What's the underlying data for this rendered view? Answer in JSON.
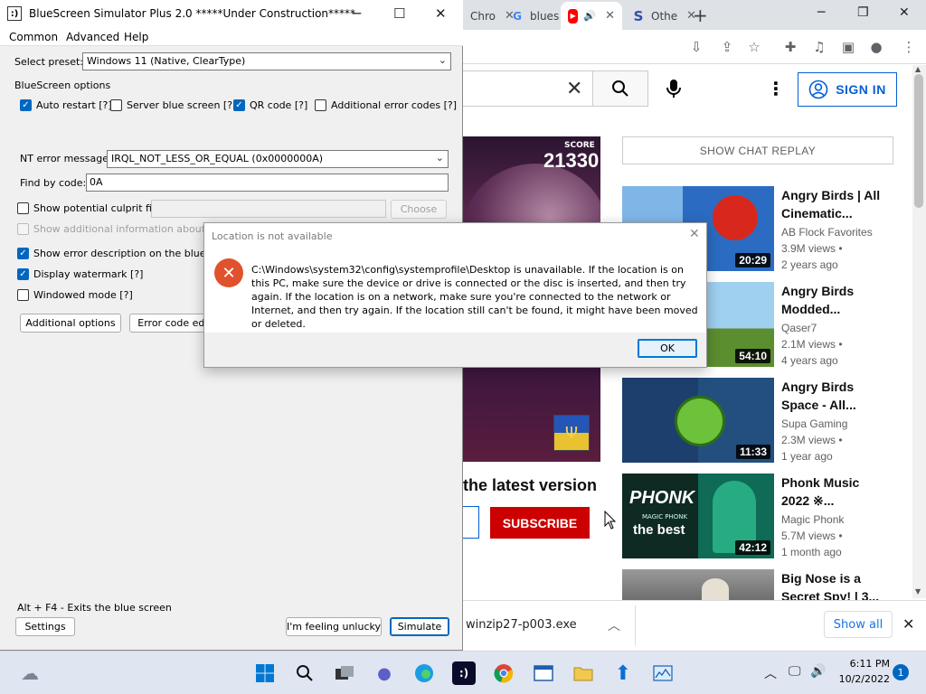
{
  "chrome": {
    "tabs": [
      {
        "label": "Chro"
      },
      {
        "label": "blues"
      },
      {
        "label": ""
      },
      {
        "label": "Othe"
      }
    ],
    "yt": {
      "signin": "SIGN IN",
      "score_label": "SCORE",
      "score": "21330",
      "latest_text": "the latest version",
      "subscribe": "SUBSCRIBE",
      "chat_replay": "SHOW CHAT REPLAY",
      "recommendations": [
        {
          "title": "Angry Birds | All\nCinematic...",
          "channel": "AB Flock Favorites",
          "stats": "3.9M views •\n2 years ago",
          "duration": "20:29"
        },
        {
          "title": "Angry Birds\nModded...",
          "channel": "Qaser7",
          "stats": "2.1M views •\n4 years ago",
          "duration": "54:10"
        },
        {
          "title": "Angry Birds\nSpace - All...",
          "channel": "Supa Gaming",
          "stats": "2.3M views •\n1 year ago",
          "duration": "11:33"
        },
        {
          "title": "Phonk Music\n2022 ※...",
          "channel": "Magic Phonk",
          "stats": "5.7M views •\n1 month ago",
          "duration": "42:12",
          "thumb_text_1": "PHONK",
          "thumb_text_2": "MAGIC PHONK",
          "thumb_text_3": "the best"
        },
        {
          "title": "Big Nose is a\nSecret Spy! | 3...",
          "channel": "",
          "stats": "",
          "duration": ""
        }
      ]
    },
    "downloads": {
      "file": "winzip27-p003.exe",
      "show_all": "Show all"
    }
  },
  "bss": {
    "title": "BlueScreen Simulator Plus 2.0 *****Under Construction*****",
    "menu": [
      "Common",
      "Advanced",
      "Help"
    ],
    "preset_label": "Select preset:",
    "preset_value": "Windows 11 (Native, ClearType)",
    "options_heading": "BlueScreen options",
    "auto_restart": "Auto restart [?]",
    "server_bluescreen": "Server blue screen [?]",
    "qr_code": "QR code [?]",
    "additional_error_codes": "Additional error codes [?]",
    "nt_error_label": "NT error message:",
    "nt_error_value": "IRQL_NOT_LESS_OR_EQUAL (0x0000000A)",
    "find_by_code_label": "Find by code:",
    "find_by_code_value": "0A",
    "culprit": "Show potential culprit file",
    "choose": "Choose",
    "additional_info": "Show additional information about the fil",
    "error_desc": "Show error description on the blue scree",
    "watermark": "Display watermark [?]",
    "windowed": "Windowed mode [?]",
    "additional_options": "Additional options",
    "error_code_edit": "Error code edit",
    "hint": "Alt + F4 - Exits the blue screen",
    "settings": "Settings",
    "feeling_unlucky": "I'm feeling unlucky",
    "simulate": "Simulate"
  },
  "dialog": {
    "title": "Location is not available",
    "message": "C:\\Windows\\system32\\config\\systemprofile\\Desktop is unavailable. If the location is on this PC, make sure the device or drive is connected or the disc is inserted, and then try again. If the location is on a network, make sure you're connected to the network or Internet, and then try again. If the location still can't be found, it might have been moved or deleted.",
    "ok": "OK"
  },
  "taskbar": {
    "time": "6:11 PM",
    "date": "10/2/2022",
    "notifications": "1"
  },
  "colors": {
    "accent": "#0067c0",
    "error_icon": "#e0522c",
    "subscribe": "#cc0000",
    "signin": "#065fd4"
  }
}
